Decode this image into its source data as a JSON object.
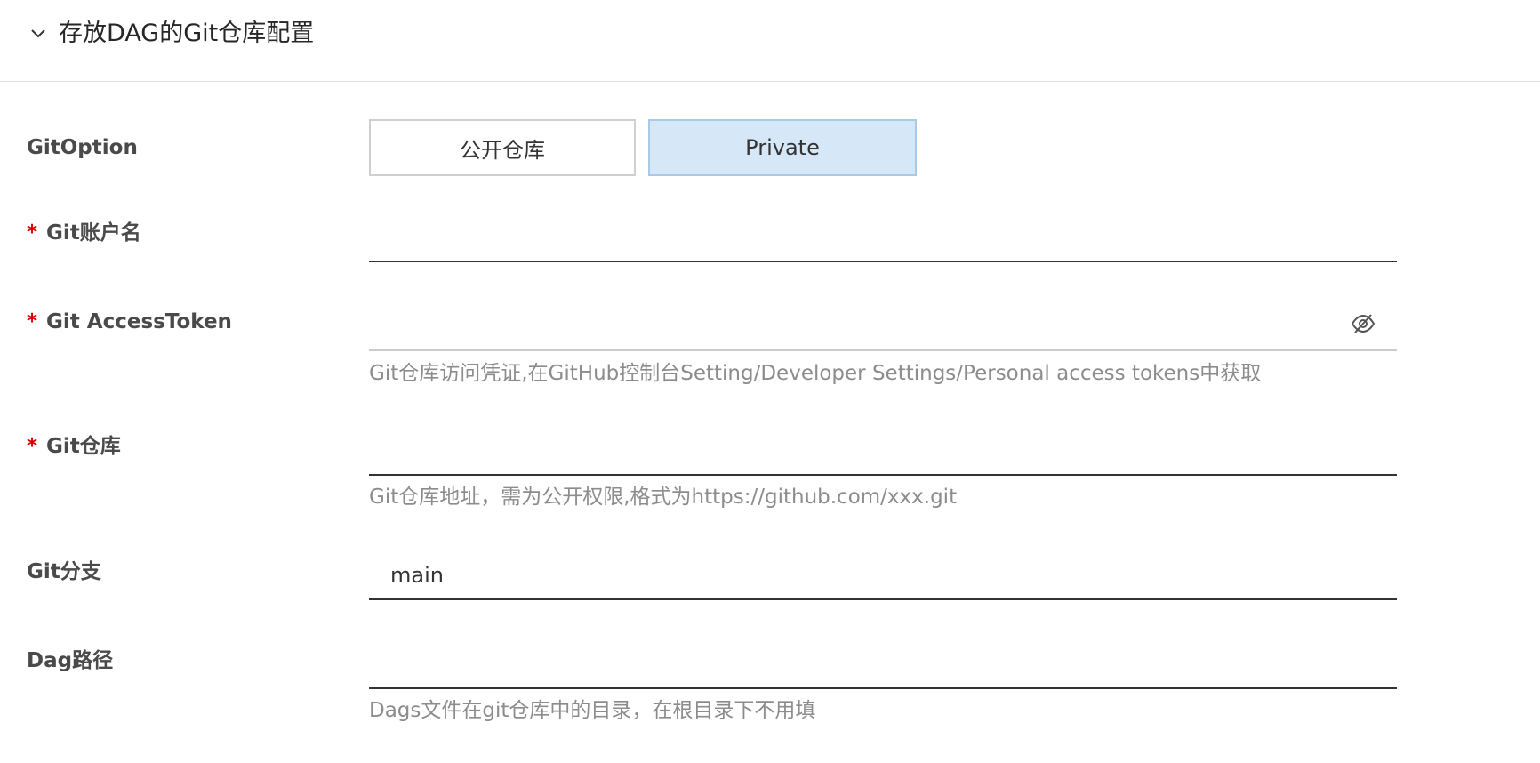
{
  "section": {
    "title": "存放DAG的Git仓库配置"
  },
  "git_option": {
    "label": "GitOption",
    "options": [
      "公开仓库",
      "Private"
    ],
    "selected": "Private"
  },
  "git_account": {
    "required_mark": "*",
    "label": "Git账户名",
    "value": ""
  },
  "git_access_token": {
    "required_mark": "*",
    "label": "Git AccessToken",
    "value": "",
    "icon": "eye-off-icon",
    "hint": "Git仓库访问凭证,在GitHub控制台Setting/Developer Settings/Personal access tokens中获取"
  },
  "git_repo": {
    "required_mark": "*",
    "label": "Git仓库",
    "value": "",
    "hint": "Git仓库地址，需为公开权限,格式为https://github.com/xxx.git"
  },
  "git_branch": {
    "label": "Git分支",
    "value": "main"
  },
  "dag_path": {
    "label": "Dag路径",
    "value": "",
    "hint": "Dags文件在git仓库中的目录，在根目录下不用填"
  }
}
